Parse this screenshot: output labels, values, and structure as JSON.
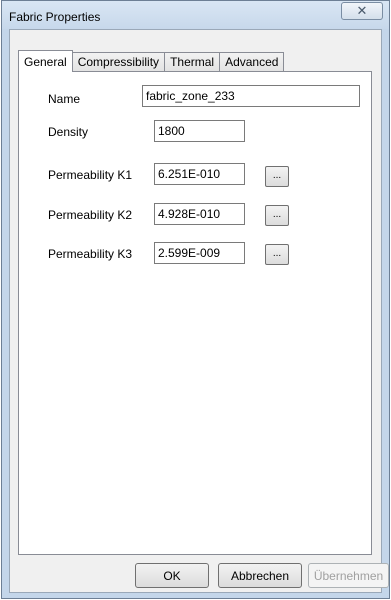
{
  "window": {
    "title": "Fabric Properties",
    "close_glyph": "✕"
  },
  "tabs": [
    {
      "label": "General",
      "active": true
    },
    {
      "label": "Compressibility",
      "active": false
    },
    {
      "label": "Thermal",
      "active": false
    },
    {
      "label": "Advanced",
      "active": false
    }
  ],
  "form": {
    "name": {
      "label": "Name",
      "value": "fabric_zone_233"
    },
    "density": {
      "label": "Density",
      "value": "1800"
    },
    "k1": {
      "label": "Permeability K1",
      "value": "6.251E-010",
      "button": "..."
    },
    "k2": {
      "label": "Permeability K2",
      "value": "4.928E-010",
      "button": "..."
    },
    "k3": {
      "label": "Permeability K3",
      "value": "2.599E-009",
      "button": "..."
    }
  },
  "buttons": {
    "ok": "OK",
    "cancel": "Abbrechen",
    "apply": "Übernehmen"
  }
}
